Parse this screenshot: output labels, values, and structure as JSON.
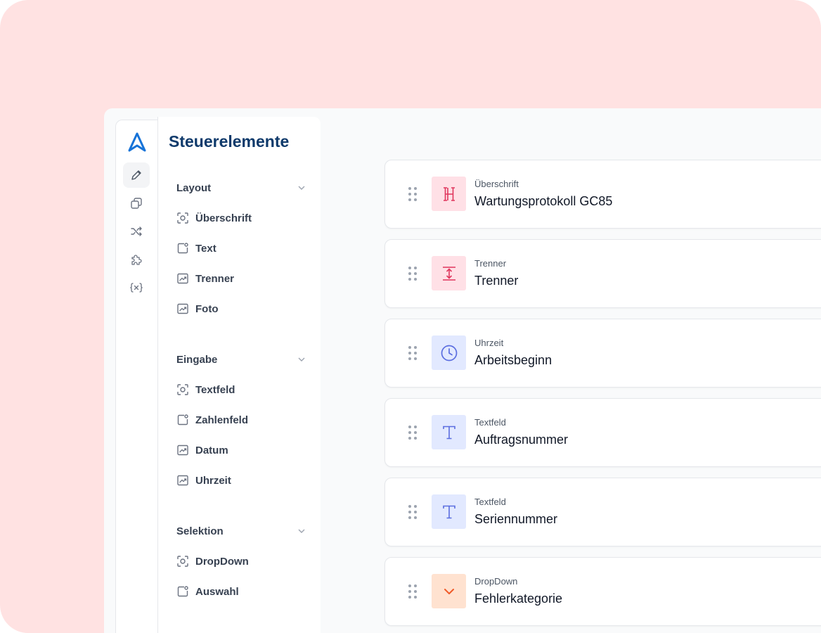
{
  "colors": {
    "background": "#ffe2e2",
    "title": "#0f3a6b",
    "pink_icon": "#e0365d",
    "blue_icon": "#5b6ee0",
    "orange_icon": "#f05a28",
    "logo": "#1673d8"
  },
  "rail": {
    "items": [
      {
        "icon": "pencil-icon"
      },
      {
        "icon": "copy-icon"
      },
      {
        "icon": "shuffle-icon"
      },
      {
        "icon": "puzzle-icon"
      },
      {
        "icon": "variable-icon"
      }
    ]
  },
  "panel": {
    "title": "Steuerelemente",
    "groups": [
      {
        "label": "Layout",
        "items": [
          {
            "label": "Überschrift",
            "icon": "scan-icon"
          },
          {
            "label": "Text",
            "icon": "frame-icon"
          },
          {
            "label": "Trenner",
            "icon": "image-chart-icon"
          },
          {
            "label": "Foto",
            "icon": "image-chart-icon"
          }
        ]
      },
      {
        "label": "Eingabe",
        "items": [
          {
            "label": "Textfeld",
            "icon": "scan-icon"
          },
          {
            "label": "Zahlenfeld",
            "icon": "frame-icon"
          },
          {
            "label": "Datum",
            "icon": "image-chart-icon"
          },
          {
            "label": "Uhrzeit",
            "icon": "image-chart-icon"
          }
        ]
      },
      {
        "label": "Selektion",
        "items": [
          {
            "label": "DropDown",
            "icon": "scan-icon"
          },
          {
            "label": "Auswahl",
            "icon": "frame-icon"
          }
        ]
      }
    ]
  },
  "cards": [
    {
      "type": "Überschrift",
      "name": "Wartungsprotokoll GC85",
      "icon": "heading-icon"
    },
    {
      "type": "Trenner",
      "name": "Trenner",
      "icon": "divider-icon"
    },
    {
      "type": "Uhrzeit",
      "name": "Arbeitsbeginn",
      "icon": "clock-icon"
    },
    {
      "type": "Textfeld",
      "name": "Auftragsnummer",
      "icon": "text-t-icon"
    },
    {
      "type": "Textfeld",
      "name": "Seriennummer",
      "icon": "text-t-icon"
    },
    {
      "type": "DropDown",
      "name": "Fehlerkategorie",
      "icon": "chevron-down-icon"
    }
  ]
}
